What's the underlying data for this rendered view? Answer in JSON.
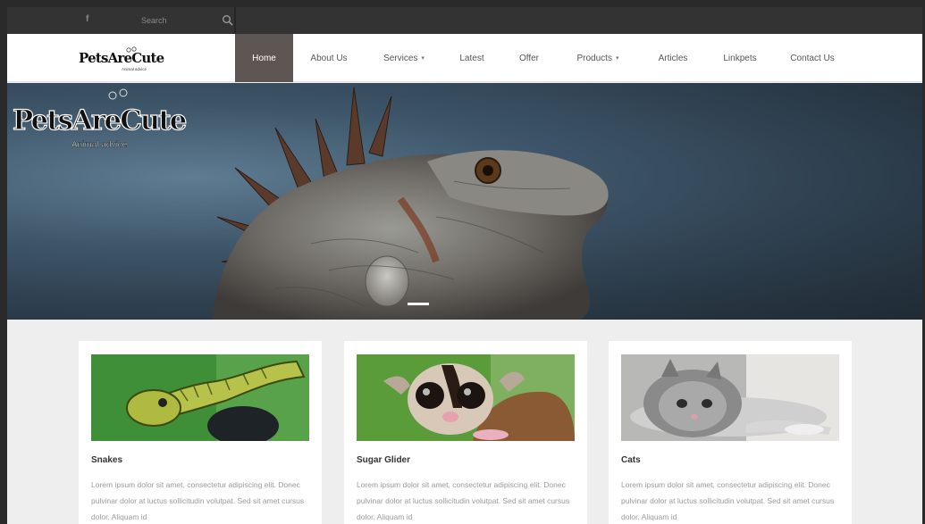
{
  "topbar": {
    "social_icon": "f",
    "search_placeholder": "Search"
  },
  "logo": {
    "text": "PetsAreCute",
    "tagline": "Animal advice"
  },
  "nav": {
    "items": [
      {
        "label": "Home",
        "active": true
      },
      {
        "label": "About Us"
      },
      {
        "label": "Services",
        "dropdown": true
      },
      {
        "label": "Latest"
      },
      {
        "label": "Offer"
      },
      {
        "label": "Products",
        "dropdown": true
      },
      {
        "label": "Articles"
      },
      {
        "label": "Linkpets"
      },
      {
        "label": "Contact Us"
      }
    ],
    "caret": "▾"
  },
  "hero": {
    "logo_text": "PetsAreCute",
    "logo_tagline": "Animal advice"
  },
  "cards": [
    {
      "title": "Snakes",
      "text": "Lorem ipsum dolor sit amet, consectetur adipiscing elit. Donec pulvinar dolor at luctus sollicitudin volutpat. Sed sit amet cursus dolor. Aliquam id"
    },
    {
      "title": "Sugar Glider",
      "text": "Lorem ipsum dolor sit amet, consectetur adipiscing elit. Donec pulvinar dolor at luctus sollicitudin volutpat. Sed sit amet cursus dolor. Aliquam id"
    },
    {
      "title": "Cats",
      "text": "Lorem ipsum dolor sit amet, consectetur adipiscing elit. Donec pulvinar dolor at luctus sollicitudin volutpat. Sed sit amet cursus dolor. Aliquam id"
    }
  ],
  "colors": {
    "topbar_bg": "#333333",
    "nav_active_bg": "#5e5653",
    "page_bg": "#eeeeee"
  }
}
